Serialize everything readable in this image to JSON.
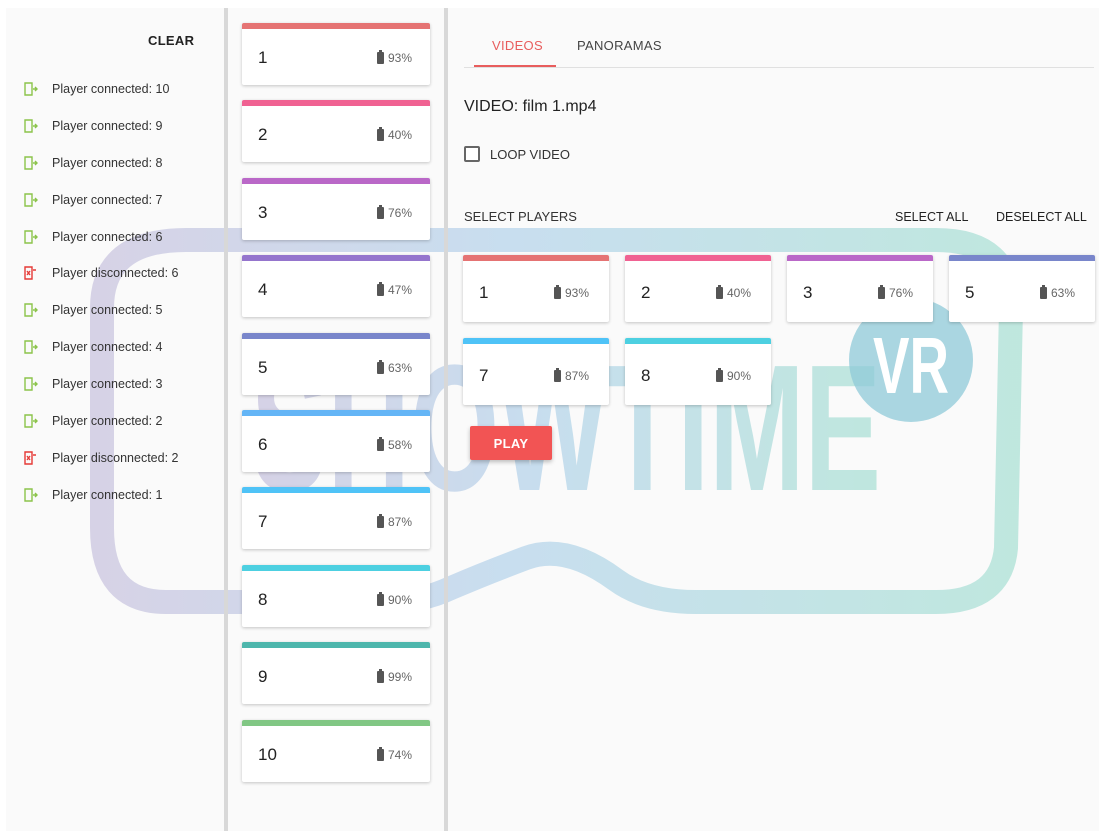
{
  "log": {
    "clear_label": "CLEAR",
    "entries": [
      {
        "text": "Player connected: 10",
        "type": "connected",
        "icon": "login-icon"
      },
      {
        "text": "Player connected: 9",
        "type": "connected",
        "icon": "login-icon"
      },
      {
        "text": "Player connected: 8",
        "type": "connected",
        "icon": "login-icon"
      },
      {
        "text": "Player connected: 7",
        "type": "connected",
        "icon": "login-icon"
      },
      {
        "text": "Player connected: 6",
        "type": "connected",
        "icon": "login-icon"
      },
      {
        "text": "Player disconnected: 6",
        "type": "disconnected",
        "icon": "logout-icon"
      },
      {
        "text": "Player connected: 5",
        "type": "connected",
        "icon": "login-icon"
      },
      {
        "text": "Player connected: 4",
        "type": "connected",
        "icon": "login-icon"
      },
      {
        "text": "Player connected: 3",
        "type": "connected",
        "icon": "login-icon"
      },
      {
        "text": "Player connected: 2",
        "type": "connected",
        "icon": "login-icon"
      },
      {
        "text": "Player disconnected: 2",
        "type": "disconnected",
        "icon": "logout-icon"
      },
      {
        "text": "Player connected: 1",
        "type": "connected",
        "icon": "login-icon"
      }
    ]
  },
  "players": [
    {
      "id": "1",
      "battery": "93%",
      "color": "#e57373"
    },
    {
      "id": "2",
      "battery": "40%",
      "color": "#f06292"
    },
    {
      "id": "3",
      "battery": "76%",
      "color": "#ba68c8"
    },
    {
      "id": "4",
      "battery": "47%",
      "color": "#9575cd"
    },
    {
      "id": "5",
      "battery": "63%",
      "color": "#7986cb"
    },
    {
      "id": "6",
      "battery": "58%",
      "color": "#64b5f6"
    },
    {
      "id": "7",
      "battery": "87%",
      "color": "#4fc3f7"
    },
    {
      "id": "8",
      "battery": "90%",
      "color": "#4dd0e1"
    },
    {
      "id": "9",
      "battery": "99%",
      "color": "#4db6ac"
    },
    {
      "id": "10",
      "battery": "74%",
      "color": "#81c784"
    }
  ],
  "tabs": {
    "videos": "VIDEOS",
    "panoramas": "PANORAMAS",
    "active": "videos"
  },
  "video": {
    "title": "VIDEO: film 1.mp4",
    "loop_label": "LOOP VIDEO",
    "loop_checked": false
  },
  "select": {
    "heading": "SELECT PLAYERS",
    "select_all": "SELECT ALL",
    "deselect_all": "DESELECT ALL"
  },
  "selected_players": [
    {
      "id": "1",
      "battery": "93%",
      "color": "#e57373"
    },
    {
      "id": "2",
      "battery": "40%",
      "color": "#f06292"
    },
    {
      "id": "3",
      "battery": "76%",
      "color": "#ba68c8"
    },
    {
      "id": "5",
      "battery": "63%",
      "color": "#7986cb"
    },
    {
      "id": "7",
      "battery": "87%",
      "color": "#4fc3f7"
    },
    {
      "id": "8",
      "battery": "90%",
      "color": "#4dd0e1"
    }
  ],
  "play_label": "PLAY",
  "watermark": {
    "word": "SHOWTIME",
    "badge": "VR"
  },
  "colors": {
    "accent": "#e85d5d",
    "connected_icon": "#8bc34a",
    "disconnected_icon": "#e53935"
  }
}
